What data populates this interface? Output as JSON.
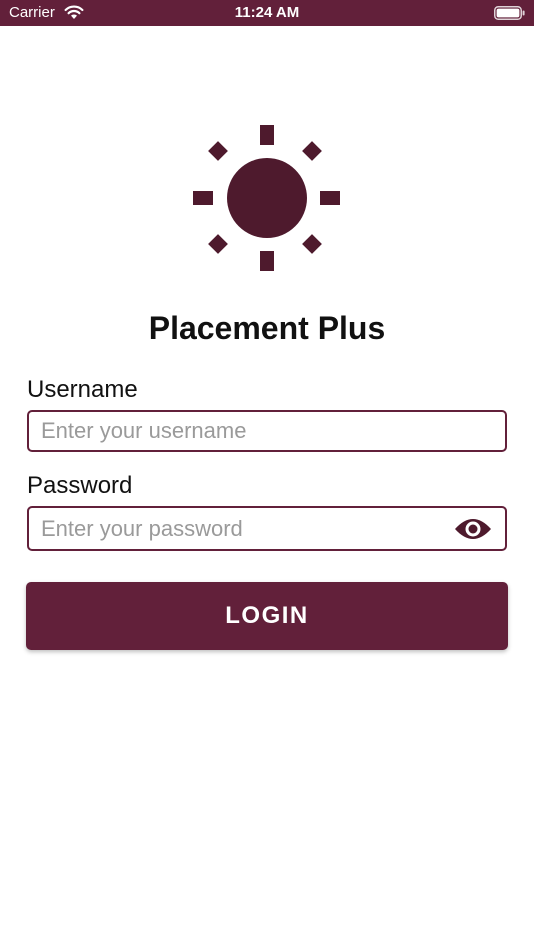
{
  "status_bar": {
    "carrier": "Carrier",
    "time": "11:24 AM",
    "wifi_icon": "wifi-icon",
    "battery_icon": "battery-icon"
  },
  "brand": {
    "title": "Placement Plus",
    "logo_icon": "sun-icon",
    "accent_color": "#62203a",
    "logo_color": "#4e1a2d"
  },
  "form": {
    "username_label": "Username",
    "username_placeholder": "Enter your username",
    "username_value": "",
    "password_label": "Password",
    "password_placeholder": "Enter your password",
    "password_value": "",
    "password_toggle_icon": "eye-icon",
    "login_label": "LOGIN"
  }
}
